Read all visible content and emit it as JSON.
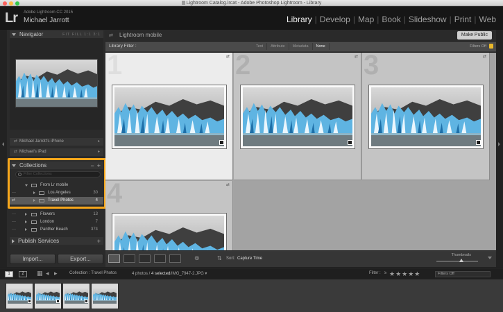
{
  "window": {
    "title": "Lightroom Catalog.lrcat - Adobe Photoshop Lightroom - Library",
    "close_color": "#fc605c",
    "minimize_color": "#fdbc40",
    "zoom_color": "#34c84a"
  },
  "identity": {
    "logo": "Lr",
    "app_name": "Adobe Lightroom CC 2015",
    "user_name": "Michael Jarrott"
  },
  "modules": [
    "Library",
    "Develop",
    "Map",
    "Book",
    "Slideshow",
    "Print",
    "Web"
  ],
  "active_module": "Library",
  "navigator": {
    "title": "Navigator",
    "zoom_levels": [
      "FIT",
      "FILL",
      "1:1",
      "3:1"
    ]
  },
  "devices": [
    {
      "label": "Michael Jarrott's iPhone"
    },
    {
      "label": "Michael's iPad"
    }
  ],
  "collections": {
    "title": "Collections",
    "minus_label": "−",
    "plus_label": "+",
    "filter_placeholder": "Filter Collections",
    "items": [
      {
        "label": "From Lr mobile",
        "count": ""
      },
      {
        "label": "Los Angeles",
        "count": "30"
      },
      {
        "label": "Travel Photos",
        "count": "4"
      },
      {
        "label": "Flowers",
        "count": "13"
      },
      {
        "label": "London",
        "count": "7"
      },
      {
        "label": "Panther Beach",
        "count": "374"
      }
    ],
    "selected": "Travel Photos",
    "highlight_color": "#f7a71b"
  },
  "publish_services": {
    "title": "Publish Services",
    "plus_label": "+"
  },
  "left_buttons": {
    "import": "Import...",
    "export": "Export..."
  },
  "mobile_bar": {
    "label": "Lightroom mobile",
    "make_public": "Make Public"
  },
  "library_filter": {
    "label": "Library Filter :",
    "tabs": [
      "Text",
      "Attribute",
      "Metadata",
      "None"
    ],
    "active_tab": "None",
    "filters_off": "Filters Off"
  },
  "grid": {
    "cells": [
      {
        "index": "1",
        "selected": true
      },
      {
        "index": "2",
        "selected": false
      },
      {
        "index": "3",
        "selected": false
      },
      {
        "index": "4",
        "selected": false
      }
    ]
  },
  "toolbar": {
    "sort_label": "Sort:",
    "sort_value": "Capture Time",
    "thumbnails_label": "Thumbnails",
    "thumbnail_size": 0.6
  },
  "filmstrip_bar": {
    "views": [
      "1",
      "2"
    ],
    "path": "Collection : Travel Photos",
    "counts_prefix": "4 photos /",
    "counts_selected": "4 selected",
    "current_file": "/IMG_7947-2.JPG ▾",
    "filter_label": "Filter :",
    "filter_value": "Filters Off",
    "rating_op": "≥"
  },
  "filmstrip": {
    "cells": [
      {
        "selected": true
      },
      {
        "selected": true
      },
      {
        "selected": true
      },
      {
        "selected": true
      }
    ]
  }
}
